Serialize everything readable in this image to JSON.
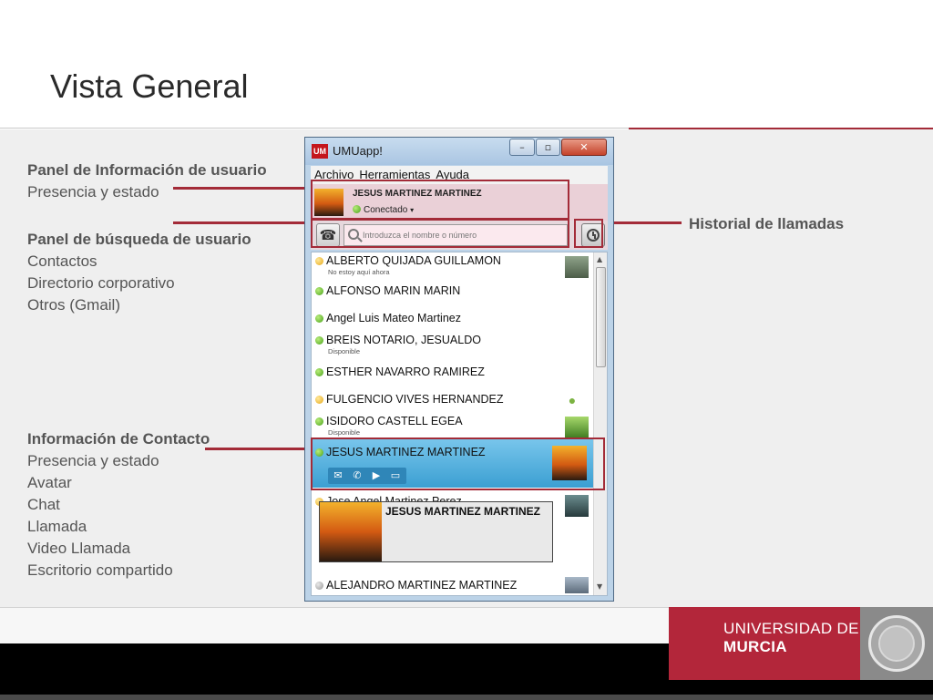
{
  "slide": {
    "title": "Vista General"
  },
  "annotations": {
    "user_panel": {
      "heading": "Panel de Información de usuario",
      "lines": [
        "Presencia y estado"
      ]
    },
    "search_panel": {
      "heading": "Panel de búsqueda de usuario",
      "lines": [
        "Contactos",
        "Directorio corporativo",
        "Otros (Gmail)"
      ]
    },
    "contact_info": {
      "heading": "Información de Contacto",
      "lines": [
        "Presencia y estado",
        "Avatar",
        "Chat",
        "Llamada",
        "Video Llamada",
        "Escritorio compartido"
      ]
    },
    "call_history": "Historial de llamadas"
  },
  "app": {
    "icon_label": "UM",
    "title": "UMUapp!",
    "window_buttons": {
      "minimize": "–",
      "maximize": "▫",
      "close": "✕"
    },
    "menu": [
      "Archivo",
      "Herramientas",
      "Ayuda"
    ],
    "user": {
      "name": "JESUS MARTINEZ MARTINEZ",
      "status": "Conectado",
      "status_caret": "▾"
    },
    "search": {
      "placeholder": "Introduzca el nombre o número"
    },
    "contacts": [
      {
        "name": "ALBERTO QUIJADA GUILLAMON",
        "note": "No estoy aquí ahora",
        "status": "yellow",
        "avatar": "photo-man"
      },
      {
        "name": "ALFONSO MARIN MARIN",
        "note": "",
        "status": "green",
        "avatar": ""
      },
      {
        "name": "Angel Luis Mateo Martinez",
        "note": "",
        "status": "green",
        "avatar": ""
      },
      {
        "name": "BREIS NOTARIO, JESUALDO",
        "note": "Disponible",
        "status": "green",
        "avatar": ""
      },
      {
        "name": "ESTHER NAVARRO RAMIREZ",
        "note": "",
        "status": "green",
        "avatar": ""
      },
      {
        "name": "FULGENCIO VIVES HERNANDEZ",
        "note": "",
        "status": "yellow",
        "avatar": "android-icon"
      },
      {
        "name": "ISIDORO CASTELL EGEA",
        "note": "Disponible",
        "status": "green",
        "avatar": "android-tile"
      },
      {
        "name": "Jose Angel Martinez Perez",
        "note": "",
        "status": "yellow",
        "avatar": "photo-man"
      },
      {
        "name": "ALEJANDRO MARTINEZ MARTINEZ",
        "note": "",
        "status": "grey",
        "avatar": "photo-group"
      }
    ],
    "selected_contact": {
      "name": "JESUS MARTINEZ MARTINEZ",
      "status": "green",
      "actions": [
        {
          "name": "chat-icon",
          "glyph": "💬"
        },
        {
          "name": "call-icon",
          "glyph": "✆"
        },
        {
          "name": "video-call-icon",
          "glyph": "▶"
        },
        {
          "name": "screen-share-icon",
          "glyph": "▭"
        }
      ]
    },
    "tooltip": {
      "name": "JESUS MARTINEZ MARTINEZ"
    }
  },
  "footer": {
    "logo_line1": "UNIVERSIDAD DE",
    "logo_line2": "MURCIA"
  },
  "colors": {
    "accent_red": "#a32b38",
    "logo_red": "#b3263a",
    "selection_blue": "#3b9fd2"
  }
}
